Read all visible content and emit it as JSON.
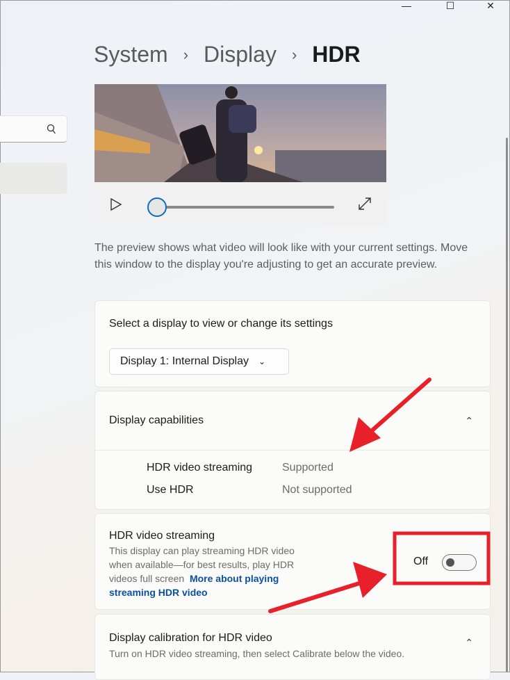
{
  "window": {
    "minimize": "—",
    "maximize": "☐",
    "close": "✕"
  },
  "breadcrumb": {
    "items": [
      "System",
      "Display"
    ],
    "current": "HDR",
    "separator": "›"
  },
  "video": {
    "progress": 0
  },
  "preview_text": "The preview shows what video will look like with your current settings. Move this window to the display you're adjusting to get an accurate preview.",
  "display_select": {
    "label": "Select a display to view or change its settings",
    "value": "Display 1: Internal Display"
  },
  "capabilities": {
    "title": "Display capabilities",
    "rows": [
      {
        "name": "HDR video streaming",
        "value": "Supported"
      },
      {
        "name": "Use HDR",
        "value": "Not supported"
      }
    ]
  },
  "streaming": {
    "title": "HDR video streaming",
    "desc": "This display can play streaming HDR video when available—for best results, play HDR videos full screen",
    "link": "More about playing streaming HDR video",
    "toggle_label": "Off",
    "toggle_on": false
  },
  "calibration": {
    "title": "Display calibration for HDR video",
    "desc": "Turn on HDR video streaming, then select Calibrate below the video."
  },
  "colors": {
    "accent": "#0f6cbd",
    "annotation": "#e8202a",
    "link": "#0a4fa3"
  }
}
